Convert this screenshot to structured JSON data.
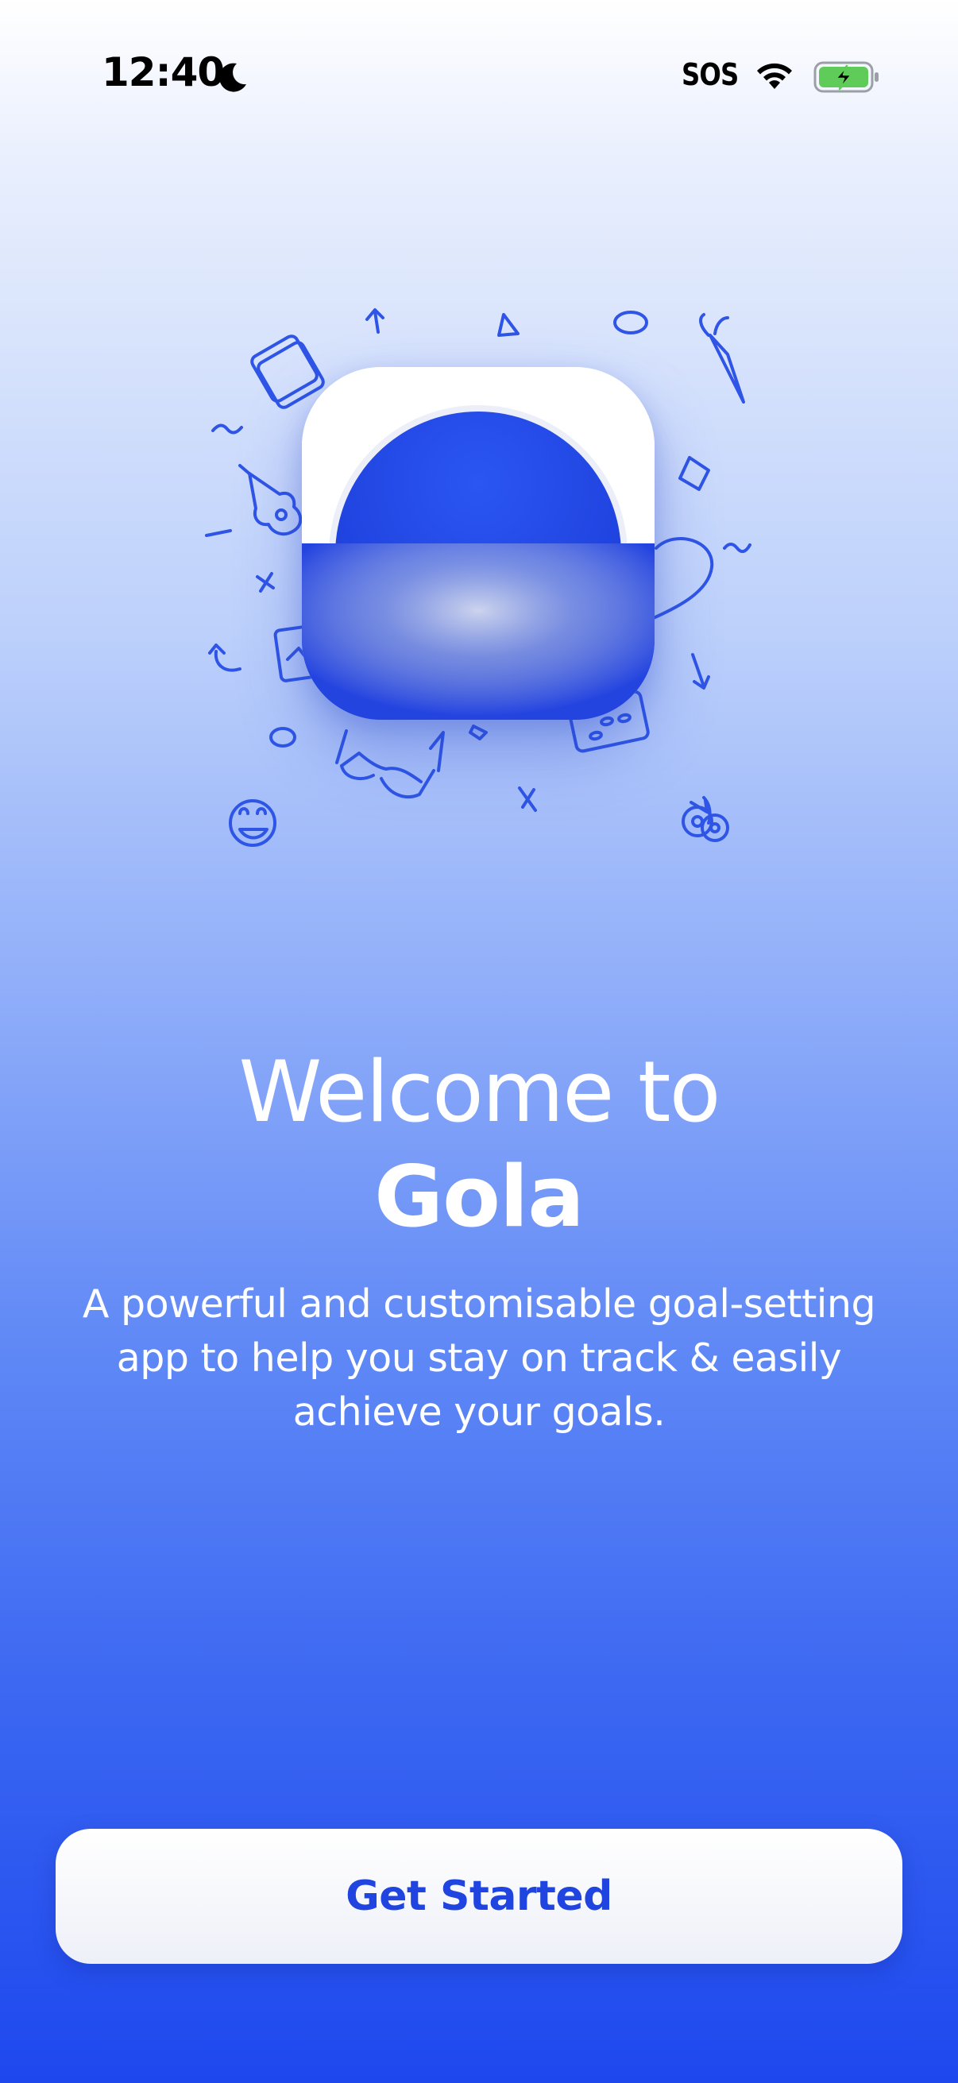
{
  "status_bar": {
    "time": "12:40",
    "carrier_status": "SOS",
    "icons": [
      "moon-icon",
      "wifi-icon",
      "battery-charging-icon"
    ]
  },
  "illustration": {
    "app_icon": "gola-app-icon",
    "doodle_icons": [
      "notebook-icon",
      "carrot-icon",
      "guitar-icon",
      "heart-icon",
      "glasses-icon",
      "bicycle-icon",
      "smiley-icon",
      "calendar-icon",
      "photo-icon"
    ]
  },
  "welcome": {
    "title": "Welcome to",
    "app_name": "Gola",
    "description": "A powerful and customisable goal-setting app to help you stay on track & easily achieve your goals."
  },
  "actions": {
    "get_started_label": "Get Started"
  },
  "colors": {
    "accent": "#1f44e0",
    "background_top": "#ffffff",
    "background_bottom": "#1e48ee",
    "battery_fill": "#5fcc5a"
  }
}
